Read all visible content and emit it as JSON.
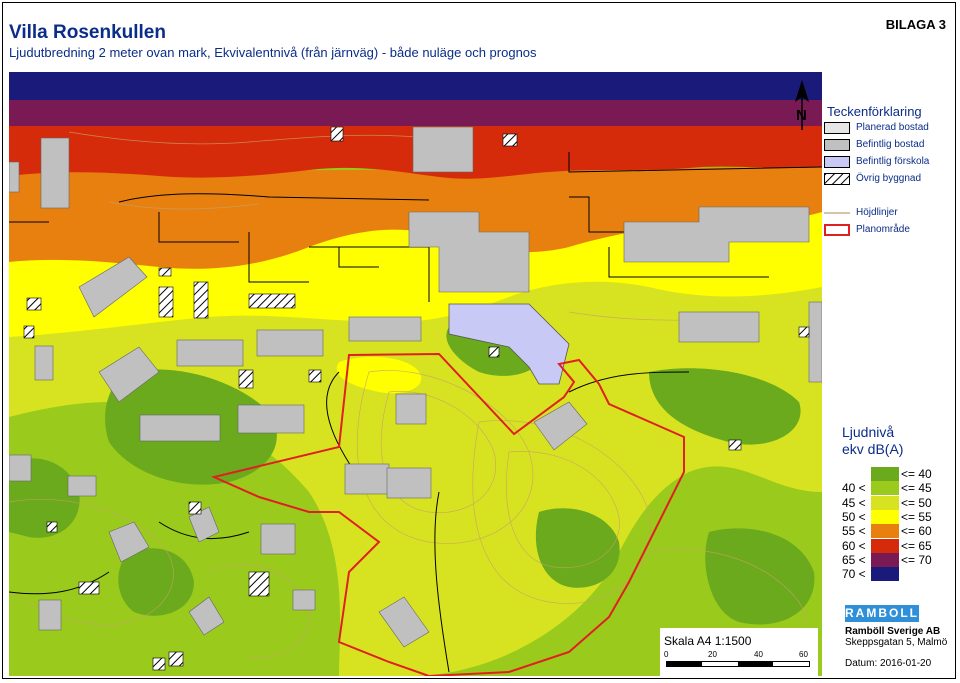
{
  "header": {
    "title": "Villa Rosenkullen",
    "subtitle": "Ljudutbredning 2 meter ovan mark, Ekvivalentnivå (från järnväg) - både nuläge och prognos",
    "bilaga": "BILAGA 3"
  },
  "legend": {
    "title": "Teckenförklaring",
    "items": [
      {
        "label": "Planerad bostad",
        "color": "#e6e6e6"
      },
      {
        "label": "Befintlig bostad",
        "color": "#c0c0c0"
      },
      {
        "label": "Befintlig förskola",
        "color": "#c9c9f5"
      },
      {
        "label": "Övrig byggnad",
        "color": "hatched"
      },
      {
        "label": "Höjdlinjer",
        "color": "#c8b08a"
      },
      {
        "label": "Planområde",
        "color": "#e02020"
      }
    ]
  },
  "noise_scale": {
    "title_line1": "Ljudnivå",
    "title_line2": "ekv dB(A)",
    "bands": [
      {
        "low": "",
        "high": "<= 40",
        "color": "#6aaa1c"
      },
      {
        "low": "40 <",
        "high": "<= 45",
        "color": "#9acb1c"
      },
      {
        "low": "45 <",
        "high": "<= 50",
        "color": "#d7e320"
      },
      {
        "low": "50 <",
        "high": "<= 55",
        "color": "#ffff00"
      },
      {
        "low": "55 <",
        "high": "<= 60",
        "color": "#e8800f"
      },
      {
        "low": "60 <",
        "high": "<= 65",
        "color": "#d62b0a"
      },
      {
        "low": "65 <",
        "high": "<= 70",
        "color": "#7a1a55"
      },
      {
        "low": "70 <",
        "high": "",
        "color": "#1a1a7a"
      }
    ]
  },
  "scale_box": {
    "label": "Skala A4 1:1500",
    "ticks": [
      "0",
      "20",
      "40",
      "60"
    ]
  },
  "company": {
    "logo": "RAMBOLL",
    "name": "Ramböll Sverige AB",
    "address": "Skeppsgatan 5, Malmö",
    "date": "Datum: 2016-01-20"
  },
  "north_arrow": {
    "label": "N",
    "icon": "north-arrow-icon"
  }
}
